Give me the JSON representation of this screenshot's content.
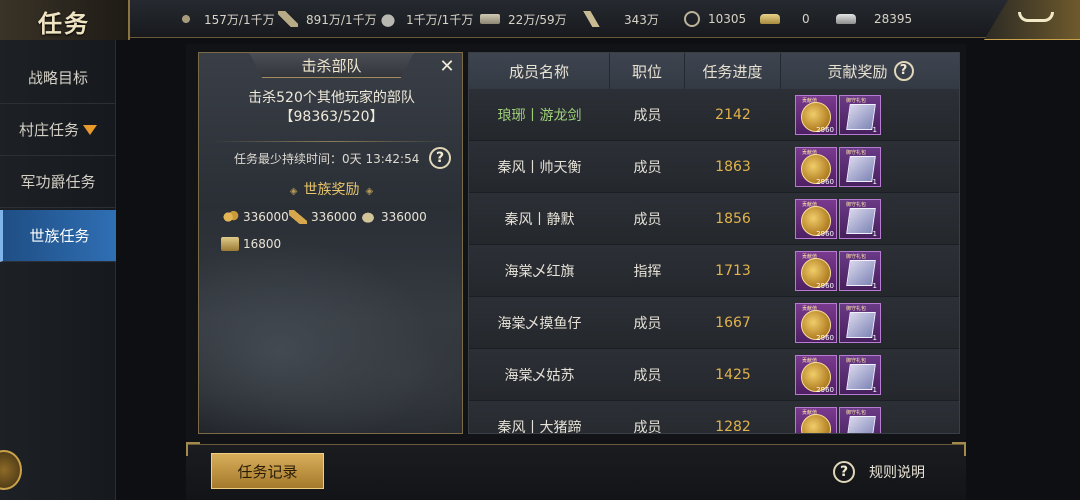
{
  "header": {
    "title": "任务",
    "resources": [
      {
        "icon": "wheat-icon",
        "value": "157万/1千万"
      },
      {
        "icon": "wood-icon",
        "value": "891万/1千万"
      },
      {
        "icon": "stone-icon",
        "value": "1千万/1千万"
      },
      {
        "icon": "iron-icon",
        "value": "22万/59万"
      },
      {
        "icon": "scroll-icon",
        "value": "343万"
      },
      {
        "icon": "copper-coin-icon",
        "value": "10305"
      },
      {
        "icon": "gold-ingot-icon",
        "value": "0"
      },
      {
        "icon": "silver-ingot-icon",
        "value": "28395"
      }
    ]
  },
  "sidebar": {
    "items": [
      {
        "label": "战略目标",
        "active": false
      },
      {
        "label": "村庄任务",
        "active": false
      },
      {
        "label": "军功爵任务",
        "active": false
      },
      {
        "label": "世族任务",
        "active": true
      }
    ]
  },
  "task": {
    "header": "击杀部队",
    "description": "击杀520个其他玩家的部队",
    "progress": "【98363/520】",
    "duration": "任务最少持续时间：0天 13:42:54",
    "reward_title": "世族奖励",
    "rewards": [
      {
        "icon": "wheat-icon",
        "value": "336000"
      },
      {
        "icon": "wood-icon",
        "value": "336000"
      },
      {
        "icon": "stone-icon",
        "value": "336000"
      },
      {
        "icon": "iron-icon",
        "value": "16800"
      }
    ]
  },
  "table": {
    "headers": [
      "成员名称",
      "职位",
      "任务进度",
      "贡献奖励"
    ],
    "reward_labels": {
      "coin": "贡献值",
      "book": "御守礼包",
      "coin_count": "2960",
      "book_count": "1"
    },
    "rows": [
      {
        "name": "琅琊丨游龙剑",
        "role": "成员",
        "progress": "2142",
        "highlight": true
      },
      {
        "name": "秦风丨帅天衡",
        "role": "成员",
        "progress": "1863",
        "highlight": false
      },
      {
        "name": "秦风丨静默",
        "role": "成员",
        "progress": "1856",
        "highlight": false
      },
      {
        "name": "海棠乄红旗",
        "role": "指挥",
        "progress": "1713",
        "highlight": false
      },
      {
        "name": "海棠乄摸鱼仔",
        "role": "成员",
        "progress": "1667",
        "highlight": false
      },
      {
        "name": "海棠乄姑苏",
        "role": "成员",
        "progress": "1425",
        "highlight": false
      },
      {
        "name": "秦风丨大猪蹄",
        "role": "成员",
        "progress": "1282",
        "highlight": false
      }
    ]
  },
  "footer": {
    "record_button": "任务记录",
    "rules_label": "规则说明"
  }
}
